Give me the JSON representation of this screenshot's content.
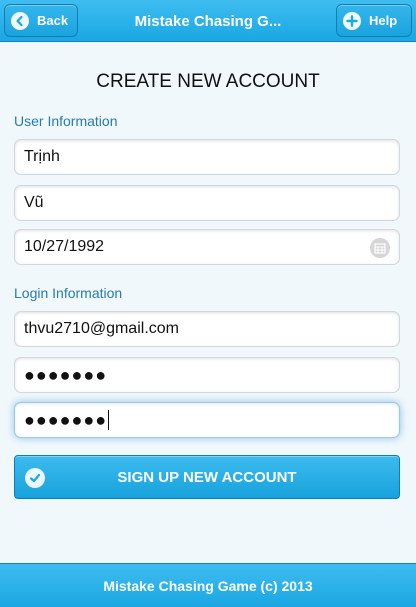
{
  "header": {
    "back_label": "Back",
    "title": "Mistake Chasing G...",
    "help_label": "Help"
  },
  "page_title": "CREATE NEW ACCOUNT",
  "user_info": {
    "label": "User Information",
    "first_name": "Trịnh",
    "last_name": "Vũ",
    "birthdate": "10/27/1992"
  },
  "login_info": {
    "label": "Login Information",
    "email": "thvu2710@gmail.com",
    "password": "●●●●●●●",
    "confirm_password": "●●●●●●●"
  },
  "signup_label": "SIGN UP NEW ACCOUNT",
  "footer_text": "Mistake Chasing Game (c) 2013",
  "colors": {
    "bar": "#1aa7e3",
    "page_bg": "#f0f8fc",
    "section_label": "#2a7ab0"
  }
}
